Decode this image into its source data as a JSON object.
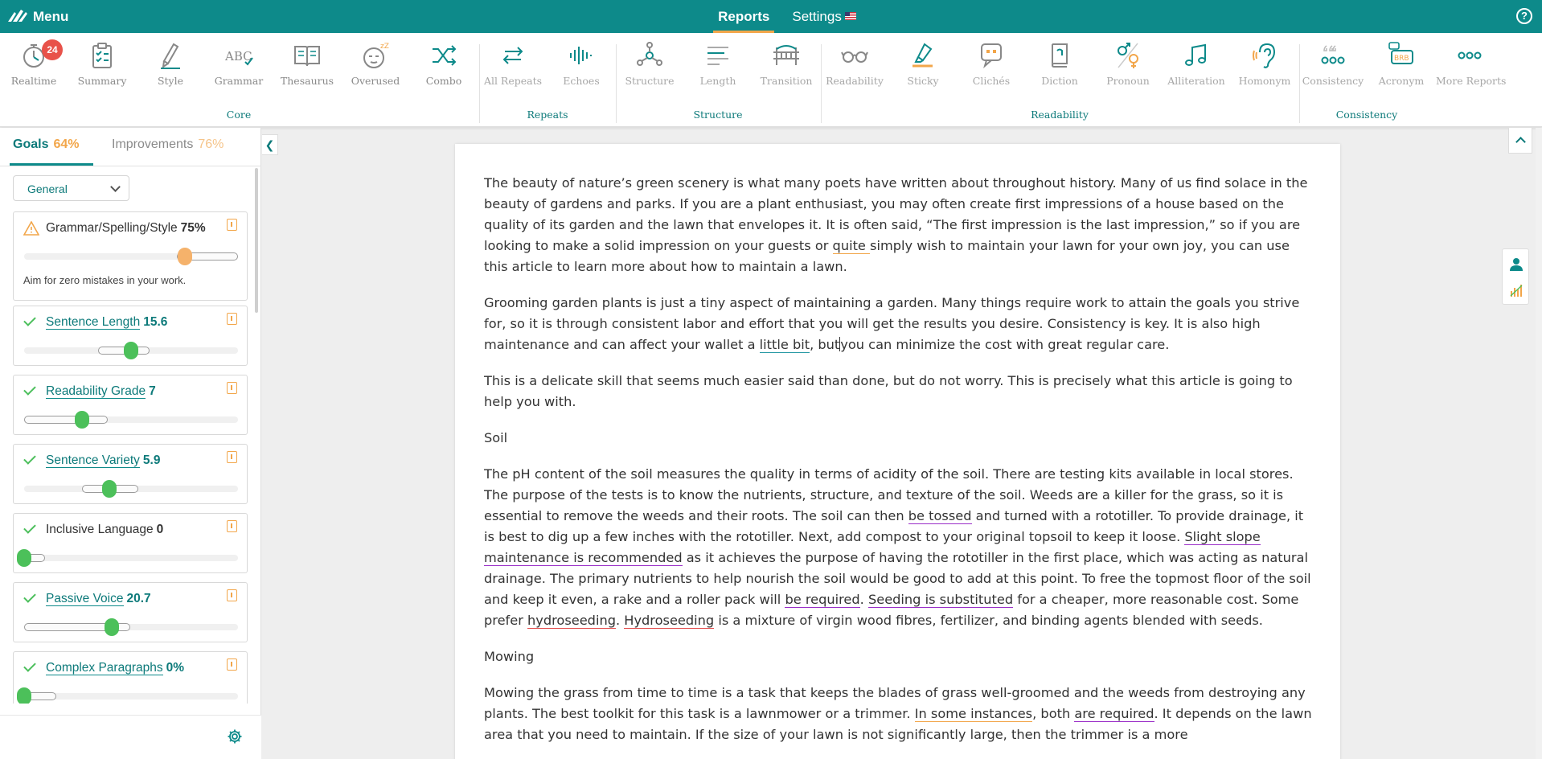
{
  "topbar": {
    "menu_label": "Menu",
    "tabs": [
      "Reports",
      "Settings"
    ],
    "help_label": "?"
  },
  "toolbar": {
    "realtime_badge": "24",
    "tools": [
      "Realtime",
      "Summary",
      "Style",
      "Grammar",
      "Thesaurus",
      "Overused",
      "Combo",
      "All Repeats",
      "Echoes",
      "Structure",
      "Length",
      "Transition",
      "Readability",
      "Sticky",
      "Clichés",
      "Diction",
      "Pronoun",
      "Alliteration",
      "Homonym",
      "Consistency",
      "Acronym",
      "More Reports"
    ],
    "groups": [
      "Core",
      "Repeats",
      "Structure",
      "Readability",
      "Consistency"
    ],
    "acronym_icon_text": "BRB",
    "grammar_icon_text": "ABC"
  },
  "sidebar": {
    "tabs": [
      {
        "label": "Goals",
        "pct": "64%"
      },
      {
        "label": "Improvements",
        "pct": "76%"
      }
    ],
    "filter": "General",
    "goals": [
      {
        "title": "Grammar/Spelling/Style",
        "value": "75%",
        "desc": "Aim for zero mistakes in your work.",
        "status": "warn",
        "level": 0.75
      },
      {
        "title": "Sentence Length",
        "value": "15.6",
        "status": "ok",
        "level": 0.5
      },
      {
        "title": "Readability Grade",
        "value": "7",
        "status": "ok",
        "level": 0.27
      },
      {
        "title": "Sentence Variety",
        "value": "5.9",
        "status": "ok",
        "level": 0.4
      },
      {
        "title": "Inclusive Language",
        "value": "0",
        "status": "ok",
        "level": 0
      },
      {
        "title": "Passive Voice",
        "value": "20.7",
        "status": "ok",
        "level": 0.41
      },
      {
        "title": "Complex Paragraphs",
        "value": "0%",
        "status": "ok",
        "level": 0
      }
    ]
  },
  "document": {
    "p1": {
      "a": "The beauty of nature’s green scenery is what many poets have written about throughout history. Many of us find solace in the beauty of gardens and parks. If you are a plant enthusiast, you may often create first impressions of a house based on the quality of its garden and the lawn that envelopes it. It is often said, “The first impression is the last impression,” so if you are looking to make a solid impression on your guests or ",
      "u1": "quite ",
      "b": "simply wish to maintain your lawn for your own joy, you can use this article to learn more about how to maintain a lawn."
    },
    "p2": {
      "a": "Grooming garden plants is just a tiny aspect of maintaining a garden. Many things require work to attain the goals you strive for, so it is through consistent labor and effort that you will get the results you desire. Consistency is key. It is also high maintenance and can affect your wallet a ",
      "u1": "little bit",
      "b": ", but",
      "c": "you can minimize the cost with great regular care."
    },
    "p3": "This is a delicate skill that seems much easier said than done, but do not worry. This is precisely what this article is going to help you with.",
    "h_soil": "Soil",
    "p4": {
      "a": "The pH content of the soil measures the quality in terms of acidity of the soil. There are testing kits available in local stores. The purpose of the tests is to know the nutrients, structure, and texture of the soil. Weeds are a killer for the grass, so it is essential to remove the weeds and their roots. The soil can then ",
      "u1": "be tossed",
      "b": " and turned with a rototiller. To provide drainage, it is best to dig up a few inches with the rototiller. Next, add compost to your original topsoil to keep it loose. ",
      "u2": "Slight slope maintenance is recommended",
      "c": " as it achieves the purpose of having the rototiller in the first place, which was acting as natural drainage. The primary nutrients to help nourish the soil would be good to add at this point. To free the topmost floor of the soil and keep it even, a rake and a roller pack will ",
      "u3": "be required",
      "d": ". ",
      "u4": "Seeding is substituted",
      "e": " for a cheaper, more reasonable cost. Some prefer ",
      "u5": "hydroseeding",
      "f": ". ",
      "u6": "Hydroseeding",
      "g": " is a mixture of virgin wood fibres, fertilizer, and binding agents blended with seeds."
    },
    "h_mowing": "Mowing",
    "p5": {
      "a": "Mowing the grass from time to time is a task that keeps the blades of grass well-groomed and the weeds from destroying any plants. The best toolkit for this task is a lawnmower or a trimmer. ",
      "u1": "In some instances",
      "b": ", both ",
      "u2": "are required",
      "c": ". It depends on the lawn area that you need to maintain. If the size of your lawn is not significantly large, then the trimmer is a more"
    }
  },
  "colors": {
    "brand_teal": "#0d8a8a",
    "accent_orange": "#f2a64a",
    "ok_green": "#4cc05a",
    "badge_red": "#e8524a",
    "underline_purple": "#9a2ec8",
    "underline_red": "#e44a4a"
  },
  "icons": [
    "logo-icon",
    "help-icon",
    "stopwatch-icon",
    "clipboard-icon",
    "pen-icon",
    "abc-icon",
    "book-icon",
    "sleepy-face-icon",
    "shuffle-icon",
    "repeat-icon",
    "sound-wave-icon",
    "network-icon",
    "lines-icon",
    "bridge-icon",
    "glasses-icon",
    "highlighter-icon",
    "speech-quote-icon",
    "dictionary-icon",
    "gender-icon",
    "music-note-icon",
    "ear-icon",
    "quote-dots-icon",
    "brb-icon",
    "more-dots-icon",
    "warning-icon",
    "check-icon",
    "info-icon",
    "gear-icon",
    "chevron-left-icon",
    "chevron-up-icon",
    "user-icon",
    "bar-chart-icon"
  ]
}
